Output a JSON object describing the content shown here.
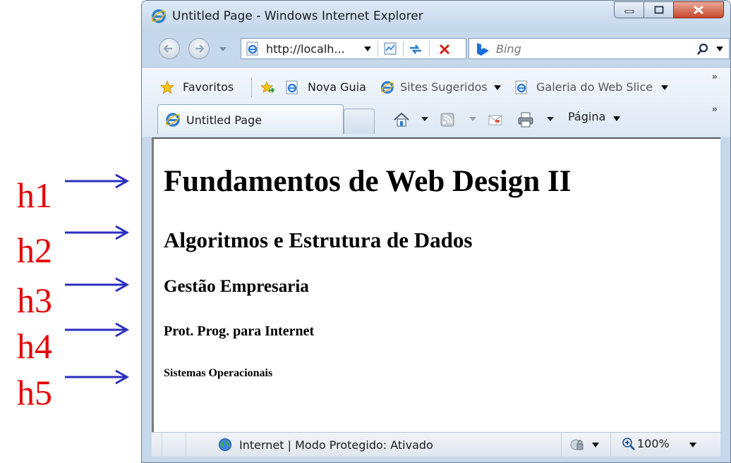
{
  "annotations": [
    {
      "label": "h1"
    },
    {
      "label": "h2"
    },
    {
      "label": "h3"
    },
    {
      "label": "h4"
    },
    {
      "label": "h5"
    }
  ],
  "window": {
    "title": "Untitled Page - Windows Internet Explorer"
  },
  "navigation": {
    "address": "http://localh...",
    "search_placeholder": "Bing"
  },
  "favorites_bar": {
    "favorites_label": "Favoritos",
    "items": [
      {
        "label": "Nova Guia"
      },
      {
        "label": "Sites Sugeridos"
      },
      {
        "label": "Galeria do Web Slice"
      }
    ]
  },
  "tab": {
    "label": "Untitled Page"
  },
  "command_bar": {
    "page_label": "Página"
  },
  "content": {
    "h1": "Fundamentos de Web Design II",
    "h2": "Algoritmos e Estrutura de Dados",
    "h3": "Gestão Empresaria",
    "h4": "Prot. Prog. para Internet",
    "h5": "Sistemas Operacionais"
  },
  "status_bar": {
    "text": "Internet | Modo Protegido: Ativado",
    "zoom": "100%"
  },
  "colors": {
    "annotation_label": "#e60000",
    "annotation_arrow": "#2b2fc0"
  }
}
